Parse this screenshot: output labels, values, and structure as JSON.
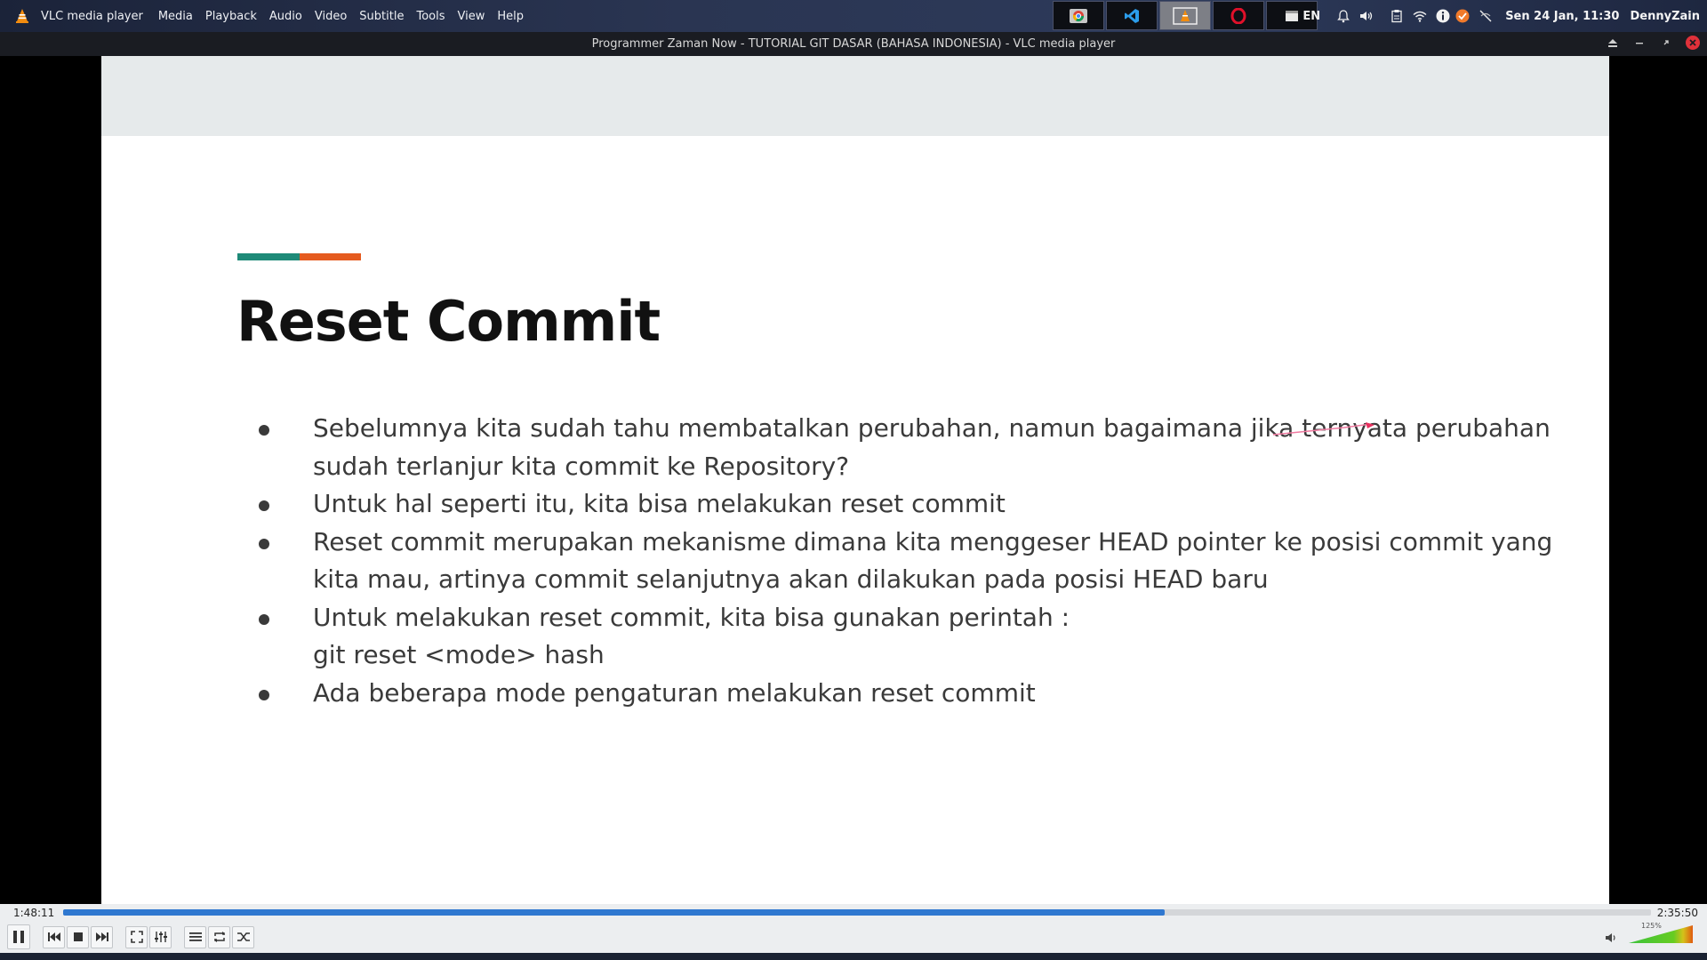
{
  "app": {
    "menubar": {
      "app_name": "VLC media player",
      "items": [
        "Media",
        "Playback",
        "Audio",
        "Video",
        "Subtitle",
        "Tools",
        "View",
        "Help"
      ]
    },
    "tray": {
      "language": "EN",
      "clock": "Sen 24 Jan, 11:30",
      "user": "DennyZain"
    },
    "taskbar_buttons": [
      "chrome-icon",
      "vscode-icon",
      "vlc-icon",
      "opera-icon",
      "terminal-icon"
    ]
  },
  "window": {
    "title": "Programmer Zaman Now - TUTORIAL GIT DASAR (BAHASA INDONESIA) - VLC media player"
  },
  "slide": {
    "title": "Reset Commit",
    "accent_colors": [
      "#1e8a78",
      "#e55b1f"
    ],
    "bullets": [
      {
        "lines": [
          "Sebelumnya kita sudah tahu membatalkan perubahan, namun bagaimana jika ternyata perubahan",
          "sudah terlanjur kita commit ke Repository?"
        ]
      },
      {
        "lines": [
          "Untuk hal seperti itu, kita bisa melakukan reset commit"
        ]
      },
      {
        "lines": [
          "Reset commit merupakan mekanisme dimana kita menggeser HEAD pointer ke posisi commit yang",
          "kita mau, artinya commit selanjutnya akan dilakukan pada posisi HEAD baru"
        ]
      },
      {
        "lines": [
          "Untuk melakukan reset commit, kita bisa gunakan perintah :",
          "git reset <mode> hash"
        ]
      },
      {
        "lines": [
          "Ada beberapa mode pengaturan melakukan reset commit"
        ]
      }
    ]
  },
  "player": {
    "time_current": "1:48:11",
    "time_total": "2:35:50",
    "progress_fraction": 0.694,
    "volume_label": "125%",
    "volume_fraction": 1.0,
    "accent_color": "#2f78d0"
  }
}
